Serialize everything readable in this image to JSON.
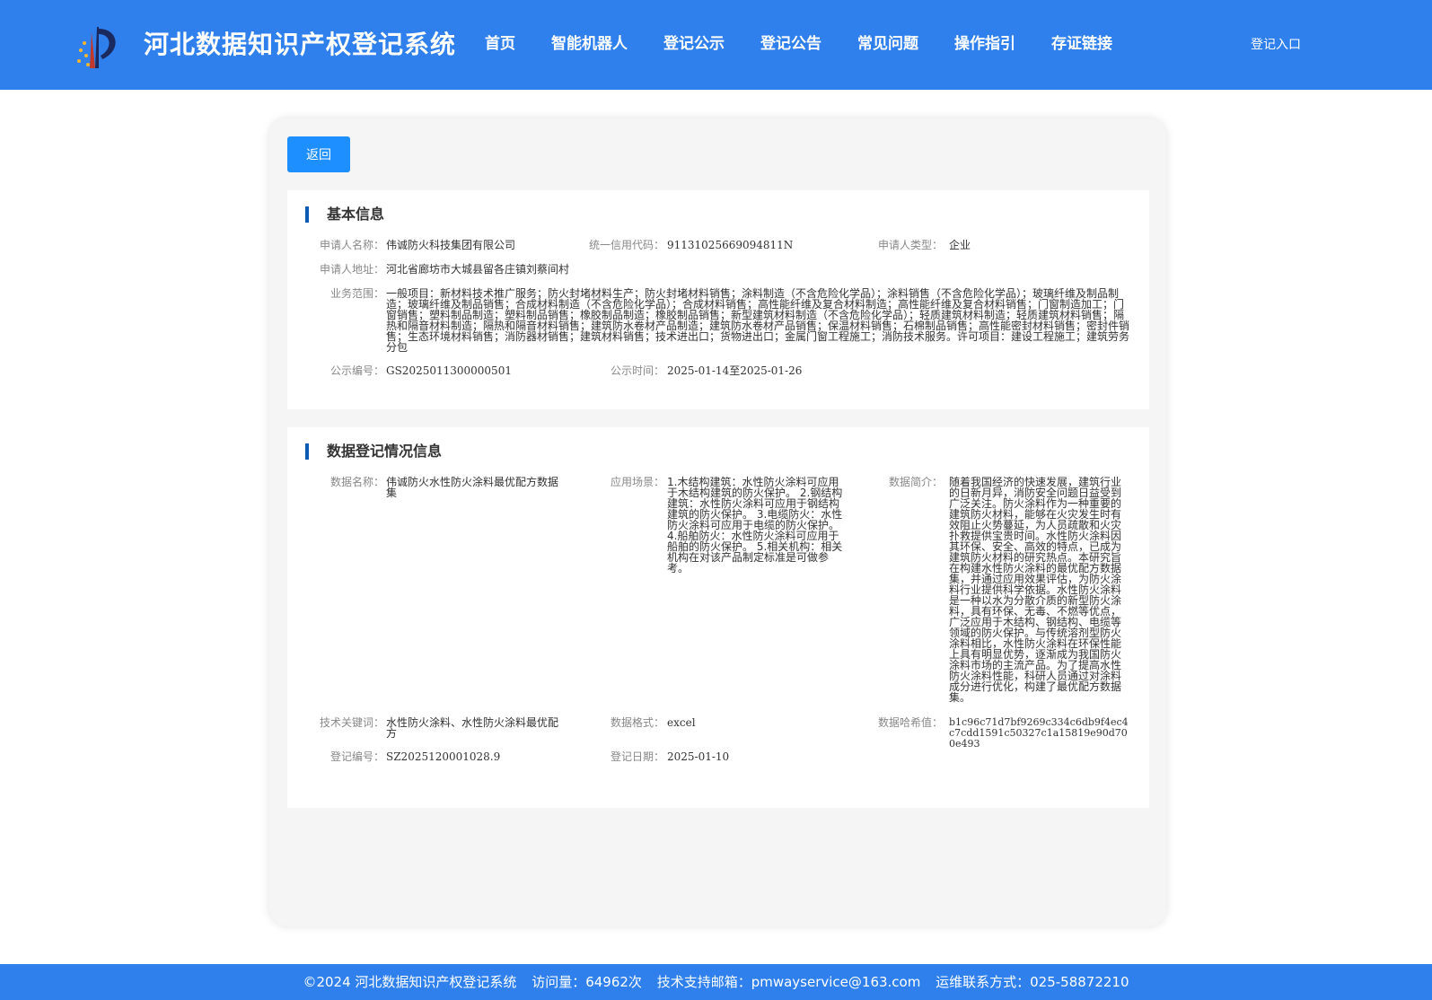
{
  "header": {
    "title": "河北数据知识产权登记系统",
    "nav": [
      "首页",
      "智能机器人",
      "登记公示",
      "登记公告",
      "常见问题",
      "操作指引",
      "存证链接"
    ],
    "login": "登记入口"
  },
  "back_label": "返回",
  "basic": {
    "title": "基本信息",
    "applicant_name_label": "申请人名称：",
    "applicant_name": "伟诚防火科技集团有限公司",
    "credit_code_label": "统一信用代码：",
    "credit_code": "91131025669094811N",
    "applicant_type_label": "申请人类型：",
    "applicant_type": "企业",
    "address_label": "申请人地址：",
    "address": "河北省廊坊市大城县留各庄镇刘蔡间村",
    "scope_label": "业务范围：",
    "scope": "一般项目：新材料技术推广服务；防火封堵材料生产；防火封堵材料销售；涂料制造（不含危险化学品）；涂料销售（不含危险化学品）；玻璃纤维及制品制造；玻璃纤维及制品销售；合成材料制造（不含危险化学品）；合成材料销售；高性能纤维及复合材料制造；高性能纤维及复合材料销售；门窗制造加工；门窗销售；塑料制品制造；塑料制品销售；橡胶制品制造；橡胶制品销售；新型建筑材料制造（不含危险化学品）；轻质建筑材料制造；轻质建筑材料销售；隔热和隔音材料制造；隔热和隔音材料销售；建筑防水卷材产品制造；建筑防水卷材产品销售；保温材料销售；石棉制品销售；高性能密封材料销售；密封件销售；生态环境材料销售；消防器材销售；建筑材料销售；技术进出口；货物进出口；金属门窗工程施工；消防技术服务。许可项目：建设工程施工；建筑劳务分包",
    "pub_no_label": "公示编号：",
    "pub_no": "GS2025011300000501",
    "pub_time_label": "公示时间：",
    "pub_time": "2025-01-14至2025-01-26"
  },
  "data_info": {
    "title": "数据登记情况信息",
    "name_label": "数据名称：",
    "name": "伟诚防火水性防火涂料最优配方数据集",
    "scene_label": "应用场景：",
    "scene": "1.木结构建筑：水性防火涂料可应用于木结构建筑的防火保护。 2.钢结构建筑：水性防火涂料可应用于钢结构建筑的防火保护。 3.电缆防火：水性防火涂料可应用于电缆的防火保护。 4.船舶防火：水性防火涂料可应用于船舶的防火保护。 5.相关机构：相关机构在对该产品制定标准是可做参考。",
    "intro_label": "数据简介：",
    "intro": "随着我国经济的快速发展，建筑行业的日新月异，消防安全问题日益受到广泛关注。防火涂料作为一种重要的建筑防火材料，能够在火灾发生时有效阻止火势蔓延，为人员疏散和火灾扑救提供宝贵时间。水性防火涂料因其环保、安全、高效的特点，已成为建筑防火材料的研究热点。本研究旨在构建水性防火涂料的最优配方数据集，并通过应用效果评估，为防火涂料行业提供科学依据。水性防火涂料是一种以水为分散介质的新型防火涂料，具有环保、无毒、不燃等优点，广泛应用于木结构、钢结构、电缆等领域的防火保护。与传统溶剂型防火涂料相比，水性防火涂料在环保性能上具有明显优势，逐渐成为我国防火涂料市场的主流产品。为了提高水性防火涂料性能，科研人员通过对涂料成分进行优化，构建了最优配方数据集。",
    "keywords_label": "技术关键词：",
    "keywords": "水性防火涂料、水性防火涂料最优配方",
    "format_label": "数据格式：",
    "format": "excel",
    "hash_label": "数据哈希值：",
    "hash": "b1c96c71d7bf9269c334c6db9f4ec4c7cdd1591c50327c1a15819e90d700e493",
    "reg_no_label": "登记编号：",
    "reg_no": "SZ2025120001028.9",
    "reg_date_label": "登记日期：",
    "reg_date": "2025-01-10"
  },
  "footer": {
    "copyright": "©2024 河北数据知识产权登记系统",
    "visits": "访问量：64962次",
    "email": "技术支持邮箱：pmwayservice@163.com",
    "phone": "运维联系方式：025-58872210"
  },
  "colors": {
    "header_bg": "#2f80ed",
    "button_bg": "#1e8fff",
    "title_bar": "#0d5bb5"
  }
}
